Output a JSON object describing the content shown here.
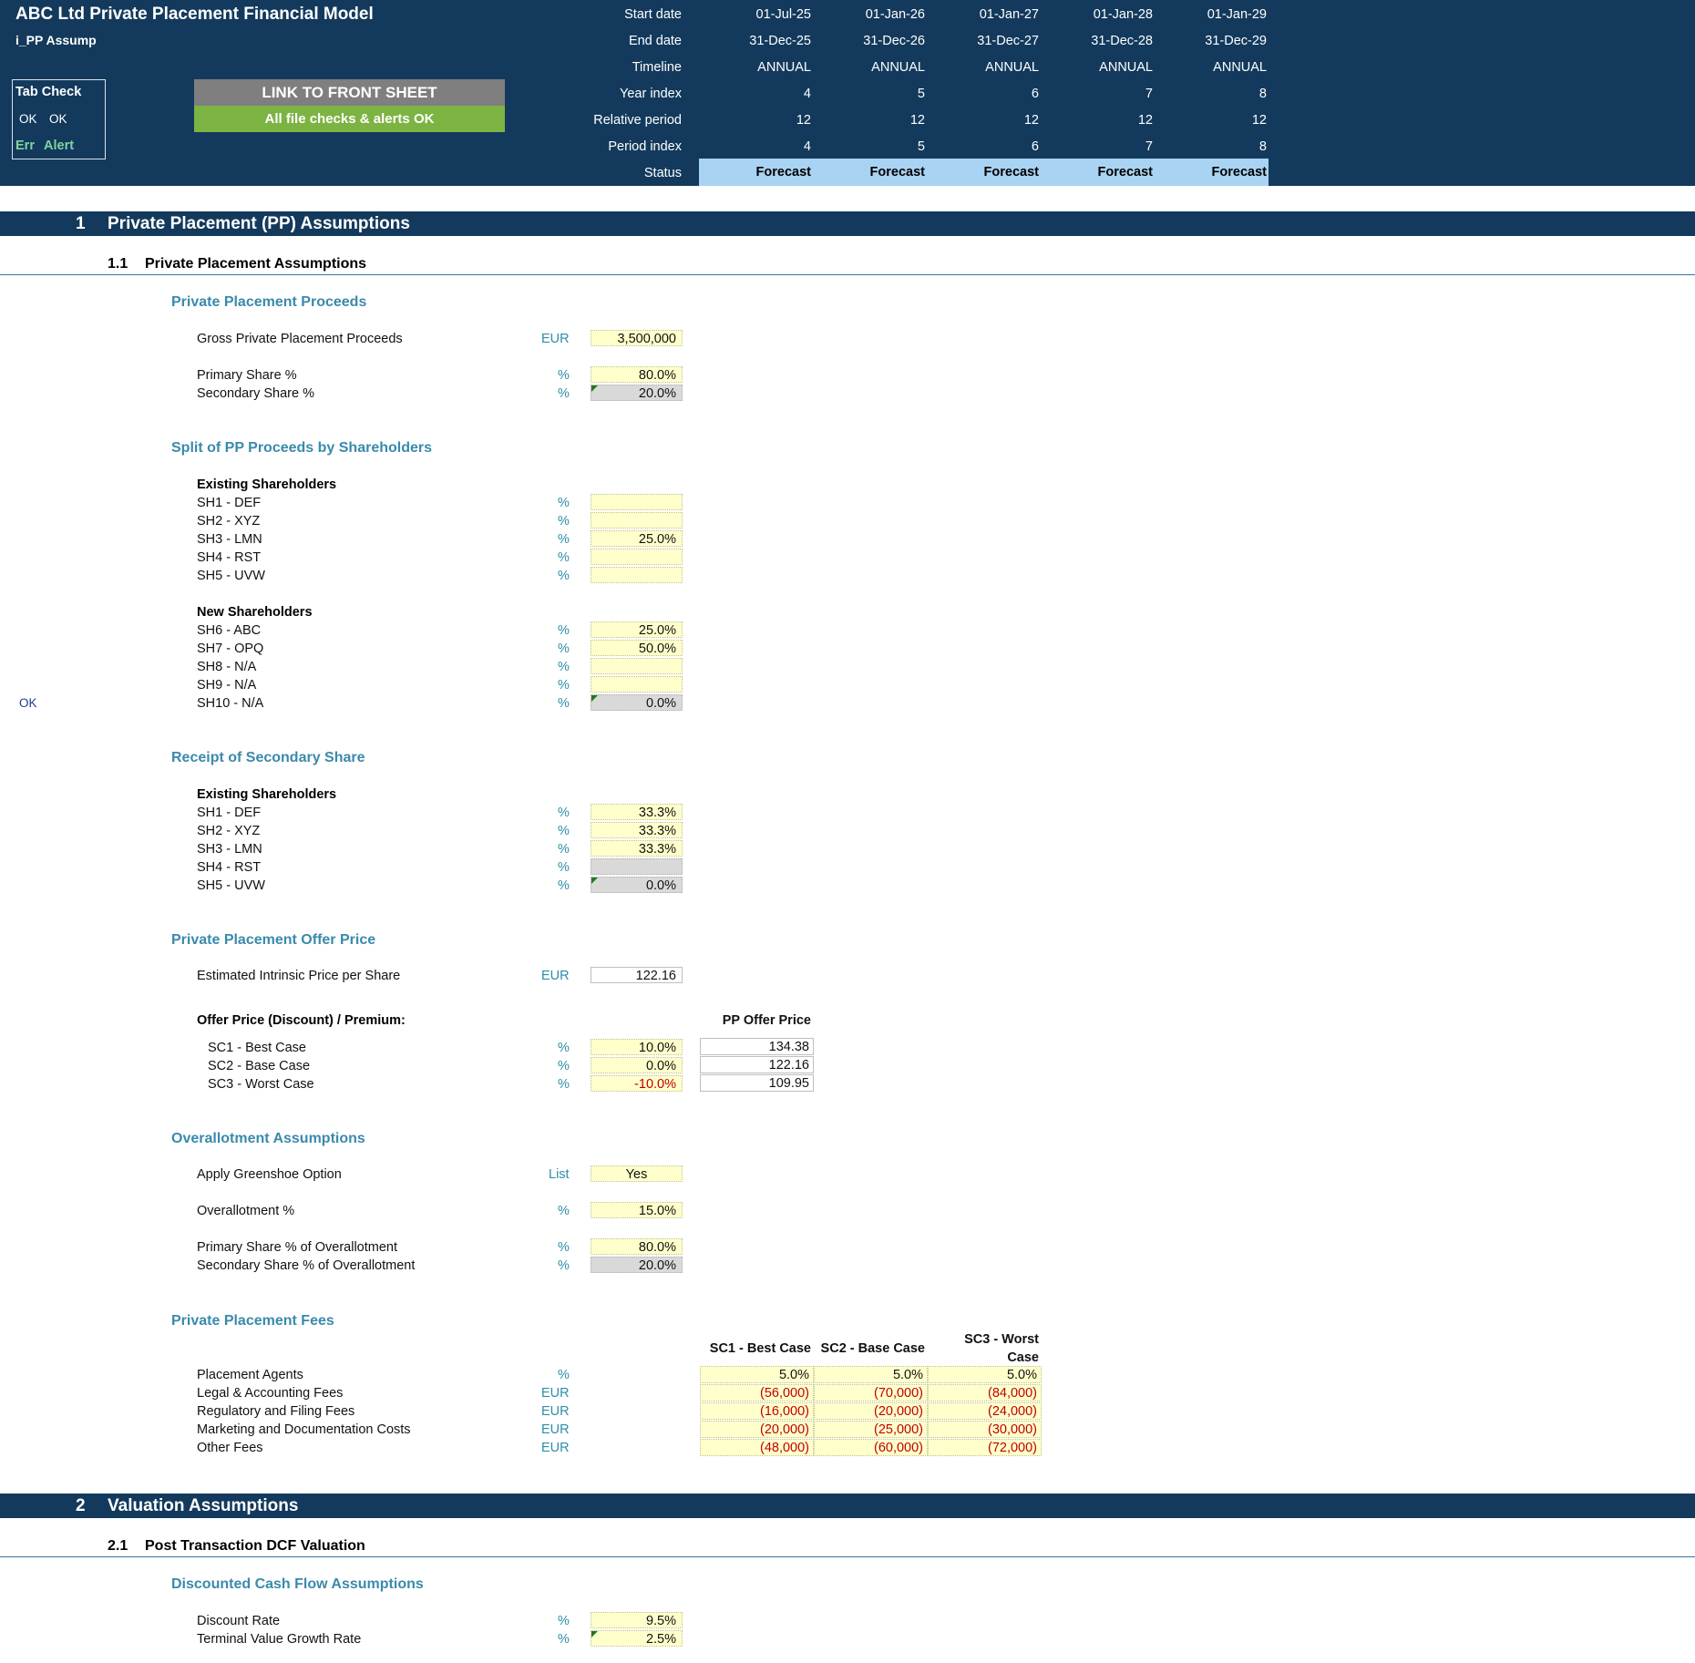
{
  "header": {
    "title": "ABC Ltd Private Placement Financial Model",
    "sheet": "i_PP Assump",
    "row_labels": [
      "Start date",
      "End date",
      "Timeline",
      "Year index",
      "Relative period",
      "Period index",
      "Status"
    ],
    "columns": [
      {
        "start": "01-Jul-25",
        "end": "31-Dec-25",
        "timeline": "ANNUAL",
        "year_index": "4",
        "relative_period": "12",
        "period_index": "4",
        "status": "Forecast"
      },
      {
        "start": "01-Jan-26",
        "end": "31-Dec-26",
        "timeline": "ANNUAL",
        "year_index": "5",
        "relative_period": "12",
        "period_index": "5",
        "status": "Forecast"
      },
      {
        "start": "01-Jan-27",
        "end": "31-Dec-27",
        "timeline": "ANNUAL",
        "year_index": "6",
        "relative_period": "12",
        "period_index": "6",
        "status": "Forecast"
      },
      {
        "start": "01-Jan-28",
        "end": "31-Dec-28",
        "timeline": "ANNUAL",
        "year_index": "7",
        "relative_period": "12",
        "period_index": "7",
        "status": "Forecast"
      },
      {
        "start": "01-Jan-29",
        "end": "31-Dec-29",
        "timeline": "ANNUAL",
        "year_index": "8",
        "relative_period": "12",
        "period_index": "8",
        "status": "Forecast"
      }
    ],
    "tab_check": {
      "title": "Tab Check",
      "ok1": "OK",
      "ok2": "OK",
      "err": "Err",
      "alert": "Alert"
    },
    "link_button": "LINK TO FRONT SHEET",
    "checks_ok": "All file checks & alerts OK"
  },
  "colors": {
    "header_bg": "#133a5c",
    "input_yellow": "#ffffcc",
    "calc_gray": "#d9d9d9",
    "status_blue": "#a9d3f2",
    "accent_teal": "#3a8aab",
    "ok_green": "#7cb342",
    "negative_red": "#c00000"
  },
  "section1": {
    "num": "1",
    "title": "Private Placement (PP) Assumptions",
    "sub_num": "1.1",
    "sub_title": "Private Placement Assumptions",
    "proceeds": {
      "title": "Private Placement Proceeds",
      "gross_label": "Gross Private Placement Proceeds",
      "gross_unit": "EUR",
      "gross_value": "3,500,000",
      "primary_label": "Primary Share %",
      "primary_unit": "%",
      "primary_value": "80.0%",
      "secondary_label": "Secondary Share %",
      "secondary_unit": "%",
      "secondary_value": "20.0%"
    },
    "split": {
      "title": "Split of PP Proceeds by Shareholders",
      "existing_label": "Existing Shareholders",
      "existing": [
        {
          "name": "SH1 - DEF",
          "unit": "%",
          "value": ""
        },
        {
          "name": "SH2 - XYZ",
          "unit": "%",
          "value": ""
        },
        {
          "name": "SH3 - LMN",
          "unit": "%",
          "value": "25.0%"
        },
        {
          "name": "SH4 - RST",
          "unit": "%",
          "value": ""
        },
        {
          "name": "SH5 - UVW",
          "unit": "%",
          "value": ""
        }
      ],
      "new_label": "New Shareholders",
      "new": [
        {
          "name": "SH6 - ABC",
          "unit": "%",
          "value": "25.0%"
        },
        {
          "name": "SH7 - OPQ",
          "unit": "%",
          "value": "50.0%"
        },
        {
          "name": "SH8 - N/A",
          "unit": "%",
          "value": ""
        },
        {
          "name": "SH9 - N/A",
          "unit": "%",
          "value": ""
        },
        {
          "name": "SH10 - N/A",
          "unit": "%",
          "value": "0.0%"
        }
      ],
      "check_flag": "OK"
    },
    "secondary_receipt": {
      "title": "Receipt of Secondary Share",
      "existing_label": "Existing Shareholders",
      "rows": [
        {
          "name": "SH1 - DEF",
          "unit": "%",
          "value": "33.3%"
        },
        {
          "name": "SH2 - XYZ",
          "unit": "%",
          "value": "33.3%"
        },
        {
          "name": "SH3 - LMN",
          "unit": "%",
          "value": "33.3%"
        },
        {
          "name": "SH4 - RST",
          "unit": "%",
          "value": ""
        },
        {
          "name": "SH5 - UVW",
          "unit": "%",
          "value": "0.0%"
        }
      ]
    },
    "offer_price": {
      "title": "Private Placement Offer Price",
      "intrinsic_label": "Estimated Intrinsic Price per Share",
      "intrinsic_unit": "EUR",
      "intrinsic_value": "122.16",
      "discount_label": "Offer Price (Discount) / Premium:",
      "pp_price_header": "PP Offer Price",
      "scenarios": [
        {
          "name": "SC1 - Best Case",
          "unit": "%",
          "pct": "10.0%",
          "price": "134.38"
        },
        {
          "name": "SC2 - Base Case",
          "unit": "%",
          "pct": "0.0%",
          "price": "122.16"
        },
        {
          "name": "SC3 - Worst Case",
          "unit": "%",
          "pct": "-10.0%",
          "price": "109.95"
        }
      ]
    },
    "overallotment": {
      "title": "Overallotment Assumptions",
      "greenshoe_label": "Apply Greenshoe Option",
      "greenshoe_unit": "List",
      "greenshoe_value": "Yes",
      "pct_label": "Overallotment %",
      "pct_unit": "%",
      "pct_value": "15.0%",
      "primary_label": "Primary Share % of Overallotment",
      "primary_unit": "%",
      "primary_value": "80.0%",
      "secondary_label": "Secondary Share % of Overallotment",
      "secondary_unit": "%",
      "secondary_value": "20.0%"
    },
    "fees": {
      "title": "Private Placement Fees",
      "headers": [
        "SC1 - Best Case",
        "SC2 - Base Case",
        "SC3 - Worst",
        "Case"
      ],
      "rows": [
        {
          "name": "Placement Agents",
          "unit": "%",
          "values": [
            "5.0%",
            "5.0%",
            "5.0%"
          ]
        },
        {
          "name": "Legal & Accounting Fees",
          "unit": "EUR",
          "values": [
            "(56,000)",
            "(70,000)",
            "(84,000)"
          ]
        },
        {
          "name": "Regulatory and Filing Fees",
          "unit": "EUR",
          "values": [
            "(16,000)",
            "(20,000)",
            "(24,000)"
          ]
        },
        {
          "name": "Marketing and Documentation Costs",
          "unit": "EUR",
          "values": [
            "(20,000)",
            "(25,000)",
            "(30,000)"
          ]
        },
        {
          "name": "Other Fees",
          "unit": "EUR",
          "values": [
            "(48,000)",
            "(60,000)",
            "(72,000)"
          ]
        }
      ]
    }
  },
  "section2": {
    "num": "2",
    "title": "Valuation Assumptions",
    "sub_num": "2.1",
    "sub_title": "Post Transaction DCF Valuation",
    "dcf": {
      "title": "Discounted Cash Flow Assumptions",
      "discount_label": "Discount Rate",
      "discount_unit": "%",
      "discount_value": "9.5%",
      "tg_label": "Terminal Value Growth Rate",
      "tg_unit": "%",
      "tg_value": "2.5%"
    }
  }
}
